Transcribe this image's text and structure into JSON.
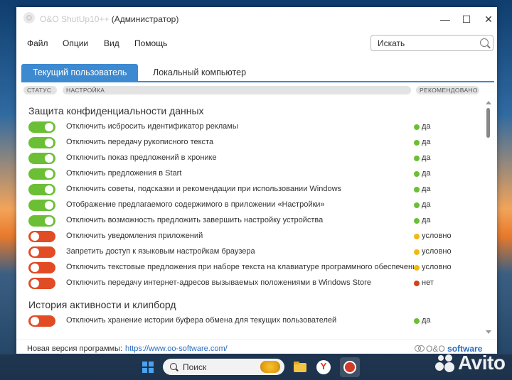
{
  "window": {
    "title_faded": "O&O ShutUp10++",
    "title_rest": " (Администратор)",
    "controls": {
      "minimize": "—",
      "maximize": "☐",
      "close": "✕"
    }
  },
  "menu": [
    "Файл",
    "Опции",
    "Вид",
    "Помощь"
  ],
  "search": {
    "placeholder": "Искать"
  },
  "tabs": [
    {
      "label": "Текущий пользователь",
      "active": true
    },
    {
      "label": "Локальный компьютер",
      "active": false
    }
  ],
  "columns": {
    "status": "СТАТУС",
    "setting": "НАСТРОЙКА",
    "recommended": "РЕКОМЕНДОВАНО"
  },
  "sections": [
    {
      "title": "Защита конфиденциальности данных",
      "rows": [
        {
          "label": "Отключить исбросить идентификатор рекламы",
          "on": true,
          "rec": "да",
          "rec_level": "green"
        },
        {
          "label": "Отключить передачу рукописного текста",
          "on": true,
          "rec": "да",
          "rec_level": "green"
        },
        {
          "label": "Отключить показ предложений в хронике",
          "on": true,
          "rec": "да",
          "rec_level": "green"
        },
        {
          "label": "Отключить предложения в Start",
          "on": true,
          "rec": "да",
          "rec_level": "green"
        },
        {
          "label": "Отключить советы, подсказки и рекомендации при использовании Windows",
          "on": true,
          "rec": "да",
          "rec_level": "green"
        },
        {
          "label": "Отображение предлагаемого содержимого в приложении «Настройки»",
          "on": true,
          "rec": "да",
          "rec_level": "green"
        },
        {
          "label": "Отключить возможность предложить завершить настройку устройства",
          "on": true,
          "rec": "да",
          "rec_level": "green"
        },
        {
          "label": "Отключить уведомления приложений",
          "on": false,
          "rec": "условно",
          "rec_level": "yellow"
        },
        {
          "label": "Запретить доступ к языковым настройкам браузера",
          "on": false,
          "rec": "условно",
          "rec_level": "yellow"
        },
        {
          "label": "Отключить текстовые предложения при наборе текста на клавиатуре программного обеспечения",
          "on": false,
          "rec": "условно",
          "rec_level": "yellow"
        },
        {
          "label": "Отключить передачу интернет-адресов вызываемых положениями в Windows Store",
          "on": false,
          "rec": "нет",
          "rec_level": "red"
        }
      ]
    },
    {
      "title": "История активности и клипборд",
      "rows": [
        {
          "label": "Отключить хранение истории буфера обмена для текущих пользователей",
          "on": false,
          "rec": "да",
          "rec_level": "green"
        }
      ]
    }
  ],
  "status_bar": {
    "text": "Новая версия программы:",
    "link": "https://www.oo-software.com/",
    "logo_prefix": "O&O",
    "logo_word": "software"
  },
  "taskbar": {
    "search_placeholder": "Поиск",
    "apps": [
      "file-explorer",
      "yandex-browser",
      "oo-shutup"
    ]
  },
  "watermark": "Avito"
}
